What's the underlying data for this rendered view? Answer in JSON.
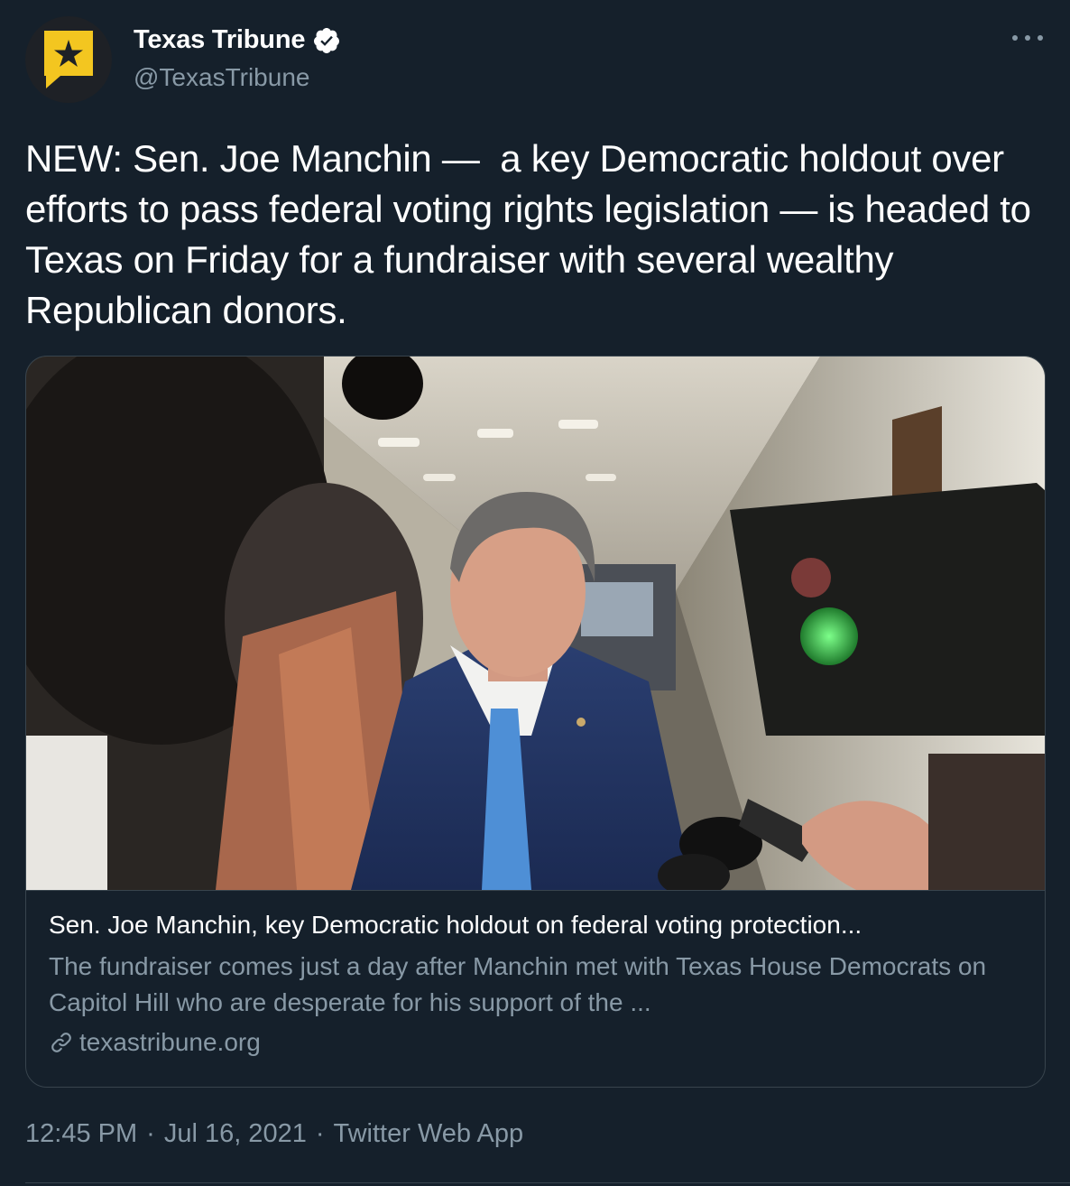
{
  "author": {
    "display_name": "Texas Tribune",
    "handle": "@TexasTribune",
    "avatar_colors": {
      "bg": "#1e2126",
      "badge": "#f3c620",
      "star": "#1e2126"
    }
  },
  "tweet": {
    "text": "NEW: Sen. Joe Manchin —  a key Democratic holdout over efforts to pass federal voting rights legislation — is headed to Texas on Friday for a fundraiser with several wealthy Republican donors."
  },
  "card": {
    "title": "Sen. Joe Manchin, key Democratic holdout on federal voting protection...",
    "description": "The fundraiser comes just a day after Manchin met with Texas House Democrats on Capitol Hill who are desperate for his support of the ...",
    "domain": "texastribune.org",
    "icon": "link-icon"
  },
  "meta": {
    "time": "12:45 PM",
    "date": "Jul 16, 2021",
    "source": "Twitter Web App",
    "separator": "·"
  },
  "colors": {
    "background": "#15202b",
    "text_primary": "#ffffff",
    "text_secondary": "#8899a6",
    "border": "#38444d"
  }
}
